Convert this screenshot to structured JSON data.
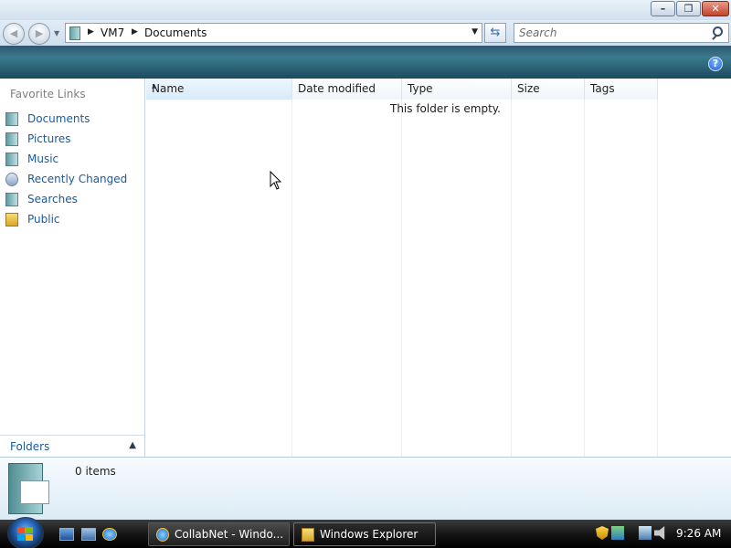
{
  "window": {
    "minimize_glyph": "–",
    "maximize_glyph": "❐",
    "close_glyph": "✕"
  },
  "nav": {
    "back_glyph": "◀",
    "forward_glyph": "▶",
    "breadcrumb": [
      "VM7",
      "Documents"
    ],
    "search_placeholder": "Search"
  },
  "command_bar": {
    "help_glyph": "?"
  },
  "favorites": {
    "title": "Favorite Links",
    "items": [
      {
        "label": "Documents",
        "icon": "documents-icon"
      },
      {
        "label": "Pictures",
        "icon": "pictures-icon"
      },
      {
        "label": "Music",
        "icon": "music-icon"
      },
      {
        "label": "Recently Changed",
        "icon": "recently-changed-icon"
      },
      {
        "label": "Searches",
        "icon": "searches-icon"
      },
      {
        "label": "Public",
        "icon": "public-folder-icon"
      }
    ],
    "folders_label": "Folders"
  },
  "filelist": {
    "columns": [
      "Name",
      "Date modified",
      "Type",
      "Size",
      "Tags"
    ],
    "sorted_column": "Name",
    "empty_message": "This folder is empty."
  },
  "details": {
    "item_count": "0 items"
  },
  "taskbar": {
    "buttons": [
      {
        "label": "CollabNet - Windo...",
        "icon": "internet-explorer-icon",
        "active": false
      },
      {
        "label": "Windows Explorer",
        "icon": "folder-icon",
        "active": true
      }
    ],
    "clock": "9:26 AM"
  },
  "colors": {
    "link": "#1a5aa0",
    "command_bar": "#2d5770",
    "taskbar": "#151515"
  }
}
